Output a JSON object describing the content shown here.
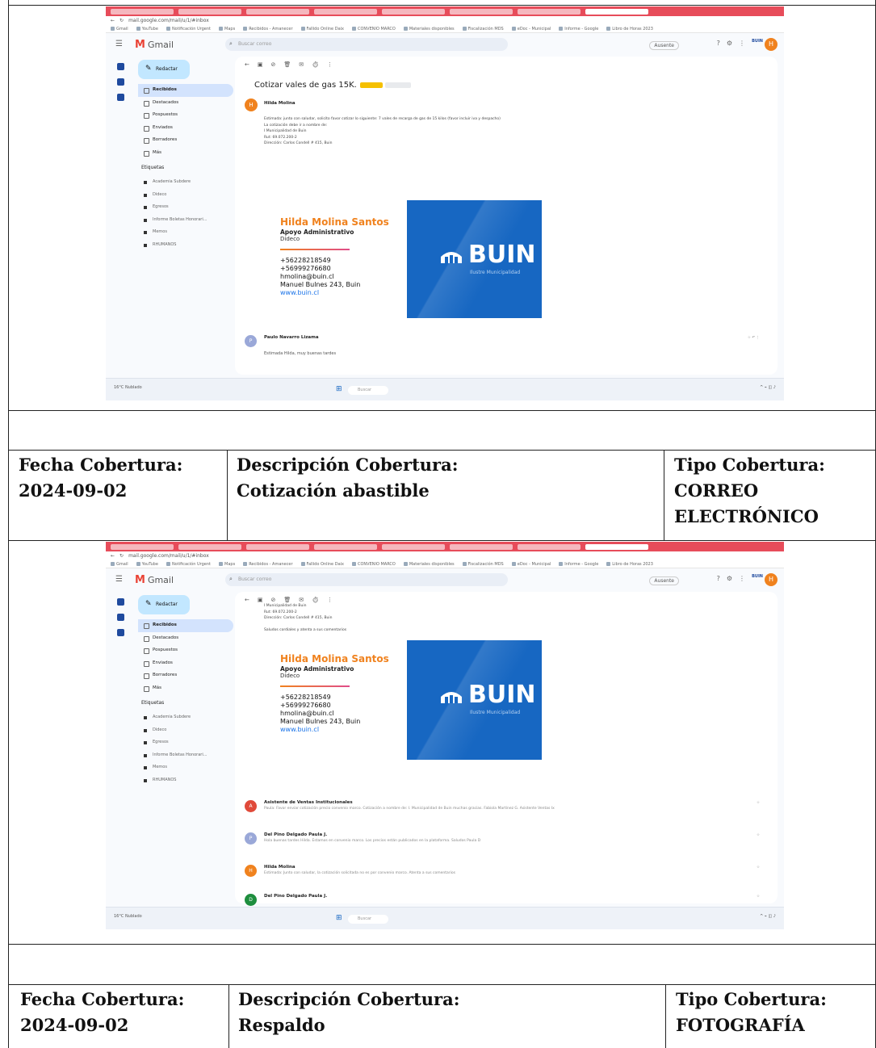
{
  "sections": [
    {
      "screenshot": {
        "address_bar": "mail.google.com/mail/u/1/#inbox",
        "bookmarks": [
          "Gmail",
          "YouTube",
          "Notificación Urgent",
          "Maps",
          "Recibidos - Amanecer",
          "Fallido Online Daix",
          "CONVENIO MARCO",
          "Materiales disponibles",
          "Fiscalización MDS",
          "eDoc - Municipal",
          "Informe - Google",
          "Libro de Horas 2023"
        ],
        "app_name": "Gmail",
        "search_placeholder": "Buscar correo",
        "status_label": "Ausente",
        "buin_badge": "BUIN",
        "avatar_letter": "H",
        "compose_label": "Redactar",
        "folders": [
          "Recibidos",
          "Destacados",
          "Pospuestos",
          "Enviados",
          "Borradores",
          "Más"
        ],
        "labels_header": "Etiquetas",
        "labels": [
          "Academia Subdere",
          "Dideco",
          "Egresos",
          "Informe Boletas Honorari...",
          "Memos",
          "RHUMANOS"
        ],
        "subject": "Cotizar vales de gas 15K.",
        "sender_name": "Hilda Molina",
        "sender_initial": "H",
        "body_lines": [
          "Estimada: junto con saludar, solicito favor cotizar lo siguiente: 7 vales de recarga de gas de 15 kilos (favor incluir iva y despacho)",
          "La cotización debe ir a nombre de:",
          "I Municipalidad de Buin",
          "Rut: 69.072.200-2",
          "Dirección: Carlos Condell # 415, Buin"
        ],
        "signature": {
          "name": "Hilda Molina Santos",
          "role": "Apoyo Administrativo",
          "dept": "Dideco",
          "phone1": "+56228218549",
          "phone2": "+56999276680",
          "email": "hmolina@buin.cl",
          "address": "Manuel Bulnes 243, Buin",
          "web": "www.buin.cl"
        },
        "banner_word": "BUIN",
        "banner_sub": "Ilustre Municipalidad",
        "reply_sender": "Paulo Navarro Lizama",
        "reply_initial": "P",
        "reply_preview": "Estimada Hilda, muy buenas tardes",
        "taskbar_weather": "16°C Nublado",
        "taskbar_search": "Buscar"
      },
      "fecha_label": "Fecha Cobertura:",
      "fecha_value": "2024-09-02",
      "descripcion_label": "Descripción Cobertura:",
      "descripcion_value": "Cotización abastible",
      "tipo_label": "Tipo Cobertura:",
      "tipo_value": "CORREO ELECTRÓNICO"
    },
    {
      "screenshot": {
        "address_bar": "mail.google.com/mail/u/1/#inbox",
        "app_name": "Gmail",
        "search_placeholder": "Buscar correo",
        "status_label": "Ausente",
        "buin_badge": "BUIN",
        "avatar_letter": "H",
        "compose_label": "Redactar",
        "folders": [
          "Recibidos",
          "Destacados",
          "Pospuestos",
          "Enviados",
          "Borradores",
          "Más"
        ],
        "labels_header": "Etiquetas",
        "labels": [
          "Academia Subdere",
          "Dideco",
          "Egresos",
          "Informe Boletas Honorari...",
          "Memos",
          "RHUMANOS"
        ],
        "body_lines": [
          "I Municipalidad de Buin",
          "Rut: 69.072.200-2",
          "Dirección: Carlos Condell # 415, Buin",
          "",
          "Saludos cordiales y atenta a sus comentarios"
        ],
        "signature": {
          "name": "Hilda Molina Santos",
          "role": "Apoyo Administrativo",
          "dept": "Dideco",
          "phone1": "+56228218549",
          "phone2": "+56999276680",
          "email": "hmolina@buin.cl",
          "address": "Manuel Bulnes 243, Buin",
          "web": "www.buin.cl"
        },
        "banner_word": "BUIN",
        "banner_sub": "Ilustre Municipalidad",
        "thread": [
          {
            "initial": "A",
            "color": "#e04a3a",
            "sender": "Asistente de Ventas Institucionales",
            "preview": "Paula: Favor enviar cotización precio convenio marco. Cotización a nombre de: I. Municipalidad de Buin muchas gracias. Fabiola Martínez G. Asistente Ventas Ix"
          },
          {
            "initial": "P",
            "color": "#9aa8d8",
            "sender": "Del Pino Delgado Paula J.",
            "preview": "Hola buenas tardes Hilda. Estamos en convenio marco. Los precios están publicados en la plataforma. Saludos Paula D"
          },
          {
            "initial": "H",
            "color": "#f0821e",
            "sender": "Hilda Molina",
            "preview": "Estimada: Junto con saludar, la cotización solicitada no es por convenio marco. Atenta a sus comentarios"
          },
          {
            "initial": "D",
            "color": "#1e8e3e",
            "sender": "Del Pino Delgado Paula J.",
            "preview": ""
          }
        ],
        "taskbar_weather": "16°C Nublado",
        "taskbar_search": "Buscar"
      },
      "fecha_label": "Fecha Cobertura:",
      "fecha_value": "2024-09-02",
      "descripcion_label": "Descripción Cobertura:",
      "descripcion_value": "Respaldo",
      "tipo_label": "Tipo Cobertura:",
      "tipo_value": "FOTOGRAFÍA"
    }
  ]
}
